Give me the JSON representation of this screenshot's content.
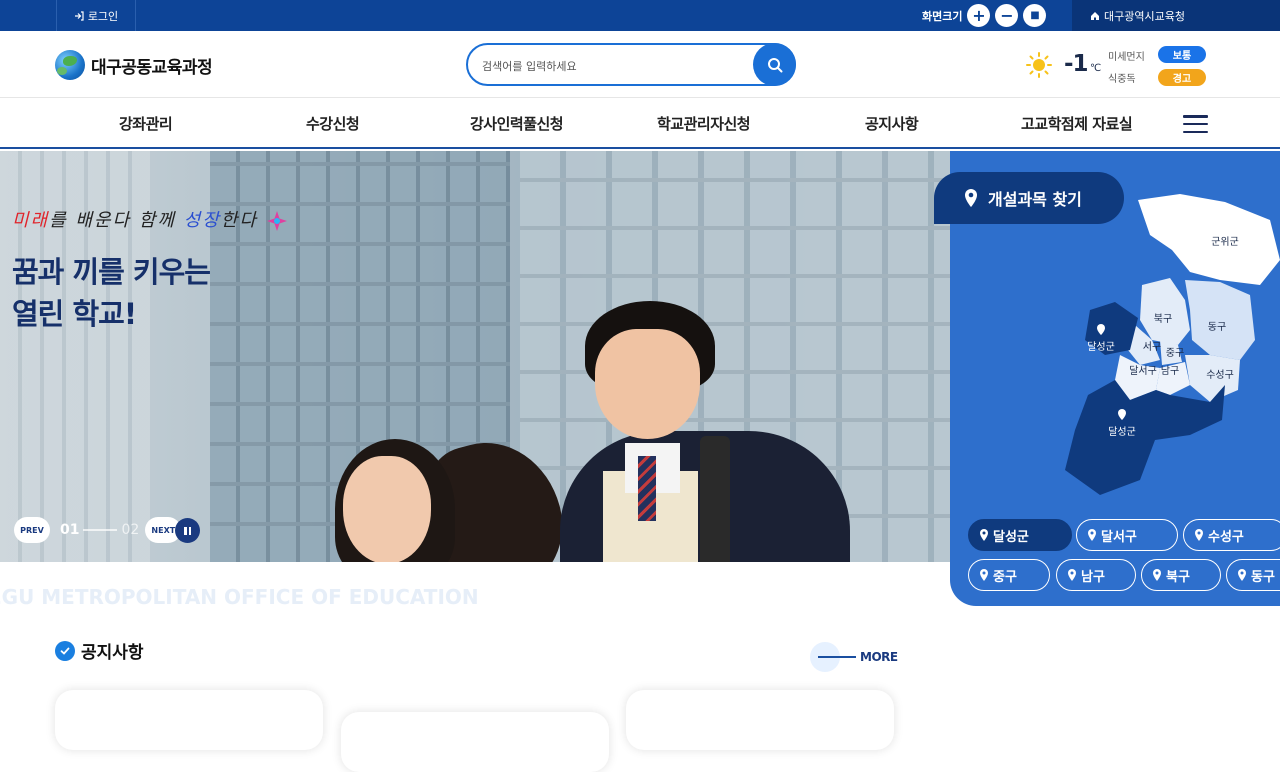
{
  "topbar": {
    "login_label": "로그인",
    "zoom_label": "화면크기",
    "zoom_in": "+",
    "zoom_out": "−",
    "zoom_reset": "■",
    "home_label": "대구광역시교육청"
  },
  "header": {
    "site_name": "대구공동교육과정",
    "search_placeholder": "검색어를 입력하세요",
    "weather": {
      "temperature": "-1",
      "unit": "℃",
      "fine_dust_label": "미세먼지",
      "fine_dust_status": "보통",
      "food_poison_label": "식중독",
      "food_poison_status": "경고",
      "colors": {
        "normal": "#1a73e8",
        "warning": "#f2a51b"
      }
    }
  },
  "nav": {
    "items": [
      "강좌관리",
      "수강신청",
      "강사인력풀신청",
      "학교관리자신청",
      "공지사항",
      "고교학점제 자료실"
    ]
  },
  "hero": {
    "slogan_part1": "미래",
    "slogan_part2": "를 배운다 함께 ",
    "slogan_part3": "성장",
    "slogan_part4": "한다",
    "headline_line1": "꿈과 끼를 키우는",
    "headline_line2": "열린 학교!",
    "prev_label": "PREV",
    "next_label": "NEXT",
    "current_slide": "01",
    "total_slides": "02",
    "watermark": "EGU METROPOLITAN OFFICE OF EDUCATION"
  },
  "map": {
    "title": "개설과목 찾기",
    "regions_on_map": [
      "군위군",
      "북구",
      "동구",
      "달성군",
      "서구",
      "중구",
      "달서구",
      "남구",
      "수성구",
      "달성군"
    ],
    "buttons": [
      "달성군",
      "달서구",
      "수성구",
      "중구",
      "남구",
      "북구",
      "동구"
    ],
    "active_button": "달성군"
  },
  "notice": {
    "title": "공지사항",
    "more_label": "MORE"
  }
}
